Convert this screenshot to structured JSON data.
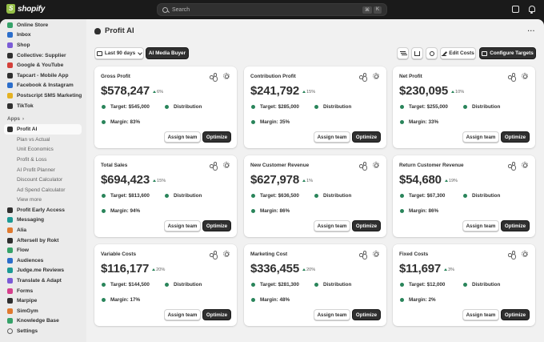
{
  "topbar": {
    "logo_text": "shopify",
    "search_placeholder": "Search",
    "shortcut_keys": [
      "⌘",
      "K"
    ]
  },
  "sidebar": {
    "items": [
      {
        "label": "Online Store",
        "icon": "online-store-icon",
        "color": "#36a269"
      },
      {
        "label": "Inbox",
        "icon": "inbox-icon",
        "color": "#2c6ecb"
      },
      {
        "label": "Shop",
        "icon": "shop-icon",
        "color": "#7b5cd6"
      },
      {
        "label": "Collective: Supplier",
        "icon": "collective-icon",
        "color": "#303030"
      },
      {
        "label": "Google & YouTube",
        "icon": "google-icon",
        "color": "#d4403a"
      },
      {
        "label": "Tapcart - Mobile App",
        "icon": "tapcart-icon",
        "color": "#303030"
      },
      {
        "label": "Facebook & Instagram",
        "icon": "facebook-icon",
        "color": "#2c6ecb"
      },
      {
        "label": "Postscript SMS Marketing",
        "icon": "postscript-icon",
        "color": "#e5b223"
      },
      {
        "label": "TikTok",
        "icon": "tiktok-icon",
        "color": "#303030"
      }
    ],
    "apps_section_label": "Apps",
    "active_app": {
      "label": "Profit AI",
      "icon": "profit-ai-icon"
    },
    "sub_items": [
      "Plan vs Actual",
      "Unit Economics",
      "Profit & Loss",
      "AI Profit Planner",
      "Discount Calculator",
      "Ad Spend Calculator",
      "View more"
    ],
    "apps": [
      {
        "label": "Profit Early Access",
        "icon": "profit-early-access-icon",
        "color": "#303030"
      },
      {
        "label": "Messaging",
        "icon": "messaging-icon",
        "color": "#1c9a95"
      },
      {
        "label": "Alia",
        "icon": "alia-icon",
        "color": "#e07a2f"
      },
      {
        "label": "Aftersell by Rokt",
        "icon": "aftersell-icon",
        "color": "#303030"
      },
      {
        "label": "Flow",
        "icon": "flow-icon",
        "color": "#36a269"
      },
      {
        "label": "Audiences",
        "icon": "audiences-icon",
        "color": "#2c6ecb"
      },
      {
        "label": "Judge.me Reviews",
        "icon": "judgeme-icon",
        "color": "#1c9a95"
      },
      {
        "label": "Translate & Adapt",
        "icon": "translate-icon",
        "color": "#7b5cd6"
      },
      {
        "label": "Forms",
        "icon": "forms-icon",
        "color": "#d63f8c"
      },
      {
        "label": "Marpipe",
        "icon": "marpipe-icon",
        "color": "#303030"
      },
      {
        "label": "SimGym",
        "icon": "simgym-icon",
        "color": "#e07a2f"
      },
      {
        "label": "Knowledge Base",
        "icon": "knowledge-base-icon",
        "color": "#36a269"
      }
    ],
    "settings_label": "Settings"
  },
  "page": {
    "title": "Profit AI",
    "more_label": "···"
  },
  "toolbar": {
    "date_range": "Last 90 days",
    "ai_media_buyer": "AI Media Buyer",
    "edit_costs": "Edit Costs",
    "configure_targets": "Configure Targets"
  },
  "cards": [
    {
      "title": "Gross Profit",
      "value": "$578,247",
      "trend": "6%",
      "target": "Target: $545,000",
      "distribution": "Distribution",
      "margin": "Margin: 83%",
      "assign": "Assign team",
      "optimize": "Optimize"
    },
    {
      "title": "Contribution Profit",
      "value": "$241,792",
      "trend": "15%",
      "target": "Target: $285,000",
      "distribution": "Distribution",
      "margin": "Margin: 35%",
      "assign": "Assign team",
      "optimize": "Optimize"
    },
    {
      "title": "Net Profit",
      "value": "$230,095",
      "trend": "10%",
      "target": "Target: $255,000",
      "distribution": "Distribution",
      "margin": "Margin: 33%",
      "assign": "Assign team",
      "optimize": "Optimize"
    },
    {
      "title": "Total Sales",
      "value": "$694,423",
      "trend": "15%",
      "target": "Target: $813,600",
      "distribution": "Distribution",
      "margin": "Margin: 94%",
      "assign": "Assign team",
      "optimize": "Optimize"
    },
    {
      "title": "New Customer Revenue",
      "value": "$627,978",
      "trend": "1%",
      "target": "Target: $636,500",
      "distribution": "Distribution",
      "margin": "Margin: 86%",
      "assign": "Assign team",
      "optimize": "Optimize"
    },
    {
      "title": "Return Customer Revenue",
      "value": "$54,680",
      "trend": "19%",
      "target": "Target: $67,300",
      "distribution": "Distribution",
      "margin": "Margin: 86%",
      "assign": "Assign team",
      "optimize": "Optimize"
    },
    {
      "title": "Variable Costs",
      "value": "$116,177",
      "trend": "20%",
      "target": "Target: $144,500",
      "distribution": "Distribution",
      "margin": "Margin: 17%",
      "assign": "Assign team",
      "optimize": "Optimize"
    },
    {
      "title": "Marketing Cost",
      "value": "$336,455",
      "trend": "20%",
      "target": "Target: $281,300",
      "distribution": "Distribution",
      "margin": "Margin: 48%",
      "assign": "Assign team",
      "optimize": "Optimize"
    },
    {
      "title": "Fixed Costs",
      "value": "$11,697",
      "trend": "3%",
      "target": "Target: $12,000",
      "distribution": "Distribution",
      "margin": "Margin: 2%",
      "assign": "Assign team",
      "optimize": "Optimize"
    }
  ],
  "colors": {
    "positive": "#29845a",
    "dark_button": "#303030",
    "page_bg": "#f1f1f1",
    "topbar_bg": "#1a1a1a"
  }
}
